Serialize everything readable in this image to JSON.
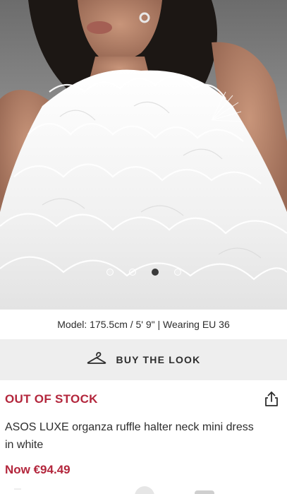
{
  "gallery": {
    "image_name": "product-photo-ruffle-dress",
    "slide_count": 4,
    "active_index": 2
  },
  "model_info": "Model: 175.5cm / 5' 9\" | Wearing EU 36",
  "buy_the_look": {
    "label": "BUY THE LOOK",
    "icon": "hanger-icon"
  },
  "stock_status": "OUT OF STOCK",
  "share_icon": "share-icon",
  "product": {
    "title": "ASOS LUXE organza ruffle halter neck mini dress in white",
    "price": "Now €94.49"
  },
  "colors": {
    "accent": "#b3263c",
    "text": "#2d2d2d",
    "button_bg": "#eeeeee"
  }
}
